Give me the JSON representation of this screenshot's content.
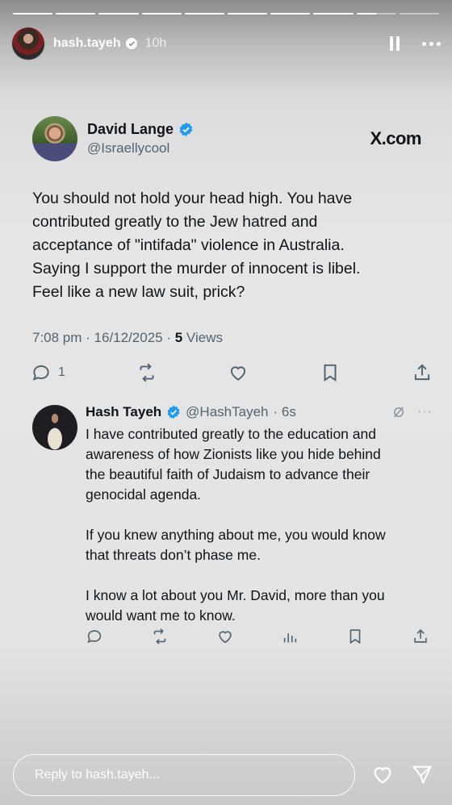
{
  "story": {
    "progress_segments": [
      1,
      1,
      1,
      1,
      1,
      1,
      1,
      1,
      0.5,
      0
    ],
    "username": "hash.tayeh",
    "time_ago": "10h",
    "reply_placeholder": "Reply to hash.tayeh..."
  },
  "tweet": {
    "author_name": "David Lange",
    "author_handle": "@Israellycool",
    "source": "X.com",
    "text": "You should not hold your head high. You have\ncontributed greatly to the Jew hatred and\nacceptance of \"intifada\" violence in Australia.\nSaying I support the murder of innocent is libel.\nFeel like a new law suit, prick?",
    "timestamp": "7:08 pm · 16/12/2025 · ",
    "views_count": "5",
    "views_label": " Views",
    "reply_count": "1"
  },
  "reply": {
    "author_name": "Hash Tayeh",
    "author_handle": "@HashTayeh",
    "time_ago": "· 6s",
    "text": "I have contributed greatly to the education and\nawareness of how Zionists like you hide behind\nthe beautiful faith of Judaism to advance their\ngenocidal agenda.\n\nIf you knew anything about me, you would know\nthat threats don’t phase me.\n\nI know a lot about you Mr. David, more than you\nwould want me to know."
  },
  "colors": {
    "verified_blue": "#1d9bf0",
    "icon_gray": "#536471"
  },
  "icons": [
    "pause-icon",
    "more-icon",
    "verified-icon",
    "reply-icon",
    "repost-icon",
    "like-icon",
    "bookmark-icon",
    "share-icon",
    "analytics-icon",
    "grok-icon",
    "heart-icon",
    "send-icon"
  ]
}
